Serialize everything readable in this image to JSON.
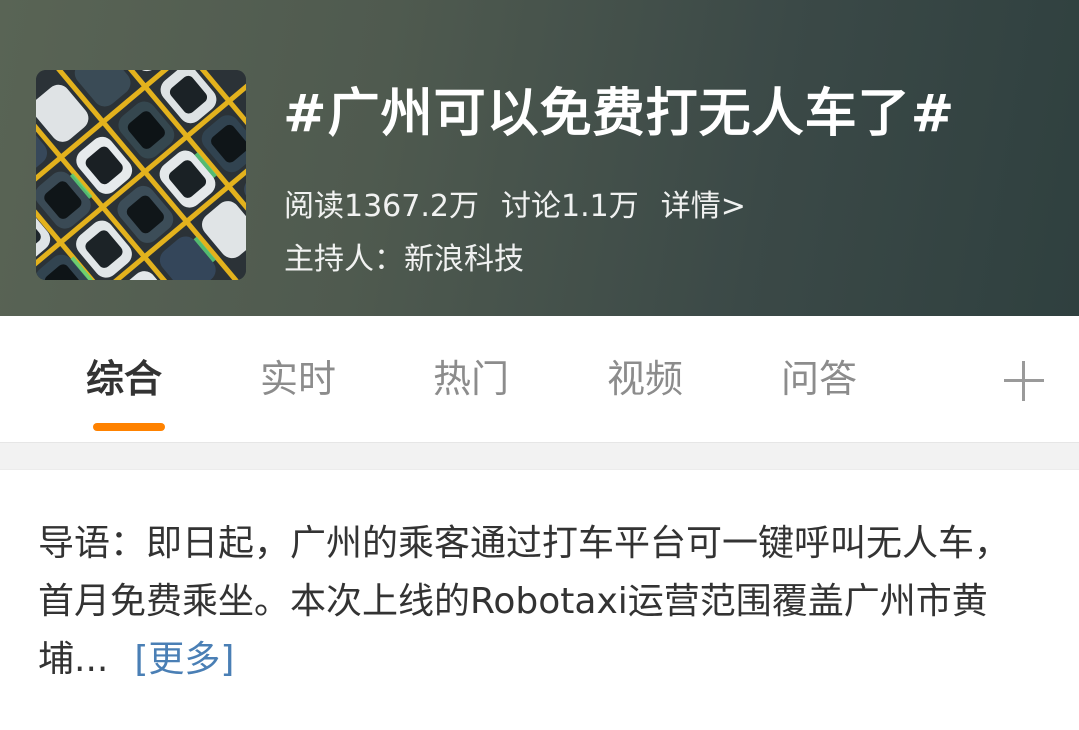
{
  "topic": {
    "title": "#广州可以免费打无人车了#",
    "stats": {
      "read": "阅读1367.2万",
      "discuss": "讨论1.1万",
      "details_link": "详情>"
    },
    "host": "主持人：新浪科技"
  },
  "tabs": [
    {
      "label": "综合",
      "active": true
    },
    {
      "label": "实时",
      "active": false
    },
    {
      "label": "热门",
      "active": false
    },
    {
      "label": "视频",
      "active": false
    },
    {
      "label": "问答",
      "active": false
    }
  ],
  "add_tab_icon": "plus-icon",
  "intro": {
    "text": "导语：即日起，广州的乘客通过打车平台可一键呼叫无人车，首月免费乘坐。本次上线的Robotaxi运营范围覆盖广州市黄埔...",
    "more_label": "[更多]"
  },
  "colors": {
    "accent_underline": "#ff8200",
    "link": "#4a7fb5",
    "header_bg": "#4f5a4f"
  }
}
